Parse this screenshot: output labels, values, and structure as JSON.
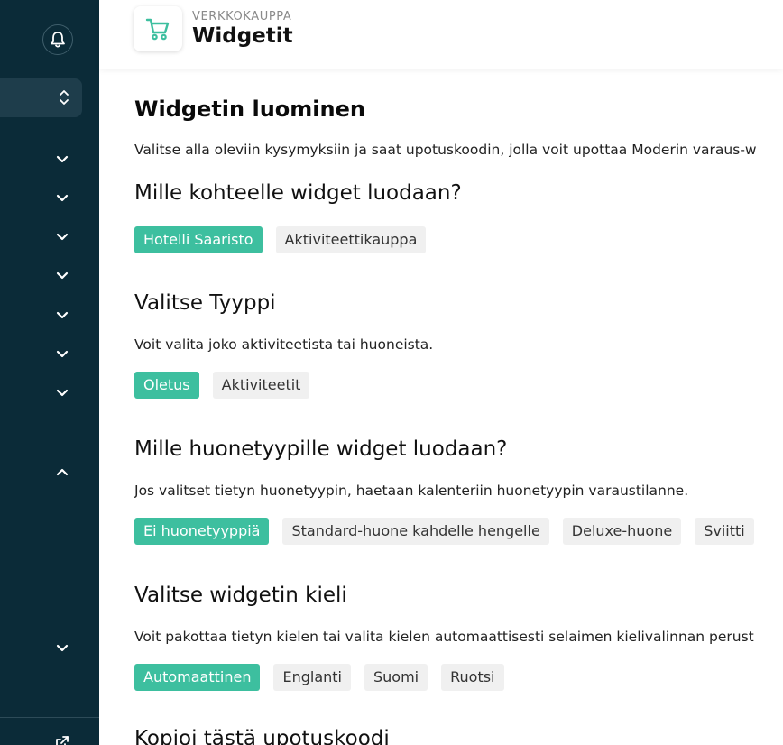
{
  "header": {
    "eyebrow": "VERKKOKAUPPA",
    "title": "Widgetit",
    "icon": "shopping-cart-icon"
  },
  "theme": {
    "sidebar_bg": "#0b2b38",
    "accent": "#3dbf9f",
    "chip_bg": "#f0f0f0"
  },
  "main": {
    "heading": "Widgetin luominen",
    "intro": "Valitse alla oleviin kysymyksiin ja saat upotuskoodin, jolla voit upottaa Moderin varaus-w",
    "target": {
      "title": "Mille kohteelle widget luodaan?",
      "options": [
        "Hotelli Saaristo",
        "Aktiviteettikauppa"
      ],
      "selected": "Hotelli Saaristo"
    },
    "type": {
      "title": "Valitse Tyyppi",
      "desc": "Voit valita joko aktiviteetista tai huoneista.",
      "options": [
        "Oletus",
        "Aktiviteetit"
      ],
      "selected": "Oletus"
    },
    "room_types": {
      "title": "Mille huonetyypille widget luodaan?",
      "desc": "Jos valitset tietyn huonetyypin, haetaan kalenteriin huonetyypin varaustilanne.",
      "options": [
        "Ei huonetyyppiä",
        "Standard-huone kahdelle hengelle",
        "Deluxe-huone",
        "Sviitti"
      ],
      "selected": "Ei huonetyyppiä"
    },
    "language": {
      "title": "Valitse widgetin kieli",
      "desc": "Voit pakottaa tietyn kielen tai valita kielen automaattisesti selaimen kielivalinnan perust",
      "options": [
        "Automaattinen",
        "Englanti",
        "Suomi",
        "Ruotsi"
      ],
      "selected": "Automaattinen"
    },
    "copy_title": "Kopioi tästä upotuskoodi"
  }
}
